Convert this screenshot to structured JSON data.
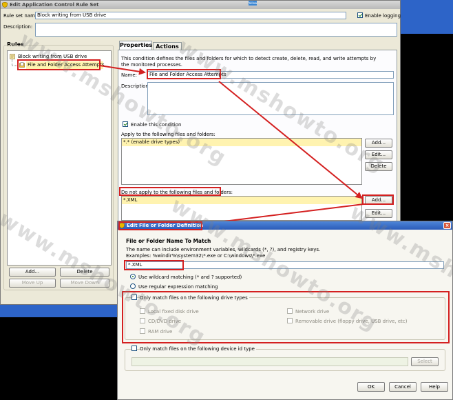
{
  "main_dialog": {
    "title": "Edit Application Control Rule Set",
    "rule_set_name_label": "Rule set name:",
    "rule_set_name_value": "Block writing from USB drive",
    "enable_logging_label": "Enable logging",
    "enable_logging_checked": true,
    "description_label": "Description:",
    "rules_group_label": "Rules",
    "tree": {
      "root": "Block writing from USB drive",
      "child": "File and Folder Access Attempts"
    },
    "buttons": {
      "add": "Add...",
      "delete": "Delete",
      "move_up": "Move Up",
      "move_down": "Move Down"
    }
  },
  "tabs": [
    {
      "label": "Properties",
      "active": true
    },
    {
      "label": "Actions",
      "active": false
    }
  ],
  "properties": {
    "intro_text": "This condition defines the files and folders for which to detect create, delete, read, and write attempts by the monitored processes.",
    "name_label": "Name:",
    "name_value": "File and Folder Access Attempts",
    "description_label": "Description:",
    "enable_condition_label": "Enable this condition",
    "enable_condition_checked": true,
    "apply_label": "Apply to the following files and folders:",
    "apply_items": [
      "*.* (enable drive types)"
    ],
    "apply_buttons": {
      "add": "Add...",
      "edit": "Edit...",
      "delete": "Delete"
    },
    "exclude_label": "Do not apply to the following files and folders:",
    "exclude_items": [
      "*.XML"
    ],
    "exclude_buttons": {
      "add": "Add...",
      "edit": "Edit..."
    }
  },
  "file_dialog": {
    "title": "Edit File or Folder Definition",
    "heading": "File or Folder Name To Match",
    "help_line1": "The name can include environment variables, wildcards (*, ?), and registry keys.",
    "help_line2": "Examples: %windir%\\system32\\*.exe or C:\\windows\\*.exe",
    "name_value": "*.XML",
    "radio_wildcard": "Use wildcard matching (* and ? supported)",
    "radio_regex": "Use regular expression matching",
    "drive_types_label": "Only match files on the following drive types",
    "drive_types": {
      "local": "Local fixed disk drive",
      "network": "Network drive",
      "cddvd": "CD/DVD drive",
      "removable": "Removable drive (floppy drive, USB drive, etc)",
      "ram": "RAM drive"
    },
    "device_label": "Only match files on the following device id type",
    "select_button": "Select",
    "ok": "OK",
    "cancel": "Cancel",
    "help": "Help"
  },
  "top_badge": "Yellow",
  "watermark": "www.mshowto.org",
  "colors": {
    "annotation_red": "#d42020",
    "selection_yellow": "#fff3b0",
    "desktop_blue": "#2d64c8"
  }
}
